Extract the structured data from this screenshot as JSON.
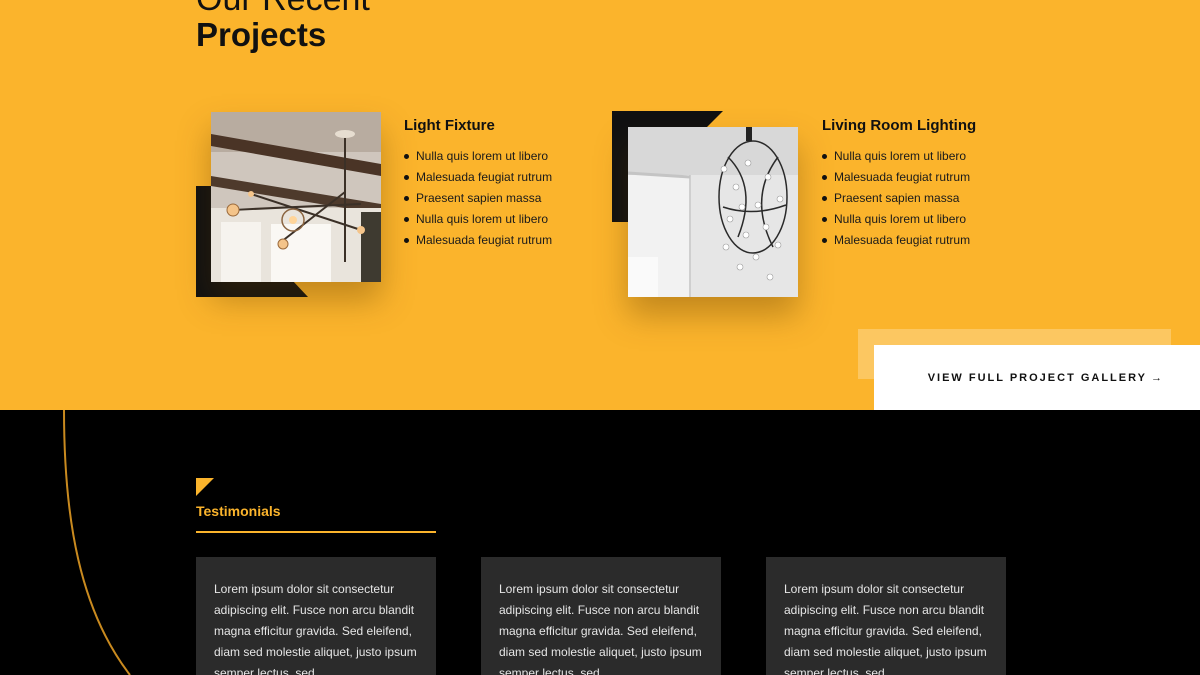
{
  "projects_section": {
    "heading_top": "Our Recent",
    "heading_main": "Projects",
    "projects": [
      {
        "title": "Light Fixture",
        "items": [
          "Nulla quis lorem ut libero",
          "Malesuada feugiat rutrum",
          "Praesent sapien massa",
          "Nulla quis lorem ut libero",
          "Malesuada feugiat rutrum"
        ]
      },
      {
        "title": "Living Room Lighting",
        "items": [
          "Nulla quis lorem ut libero",
          "Malesuada feugiat rutrum",
          "Praesent sapien massa",
          "Nulla quis lorem ut libero",
          "Malesuada feugiat rutrum"
        ]
      }
    ],
    "gallery_button": {
      "label": "VIEW FULL PROJECT GALLERY",
      "arrow": "→"
    }
  },
  "testimonials_section": {
    "label": "Testimonials",
    "cards": [
      {
        "text": "Lorem ipsum dolor sit consectetur adipiscing elit. Fusce non arcu blandit magna efficitur gravida. Sed eleifend, diam sed molestie aliquet, justo ipsum semper lectus, sed"
      },
      {
        "text": "Lorem ipsum dolor sit consectetur adipiscing elit. Fusce non arcu blandit magna efficitur gravida. Sed eleifend, diam sed molestie aliquet, justo ipsum semper lectus, sed"
      },
      {
        "text": "Lorem ipsum dolor sit consectetur adipiscing elit. Fusce non arcu blandit magna efficitur gravida. Sed eleifend, diam sed molestie aliquet, justo ipsum semper lectus, sed"
      }
    ]
  },
  "colors": {
    "accent": "#fbb42c",
    "dark": "#000000",
    "card": "#2b2b2b"
  }
}
